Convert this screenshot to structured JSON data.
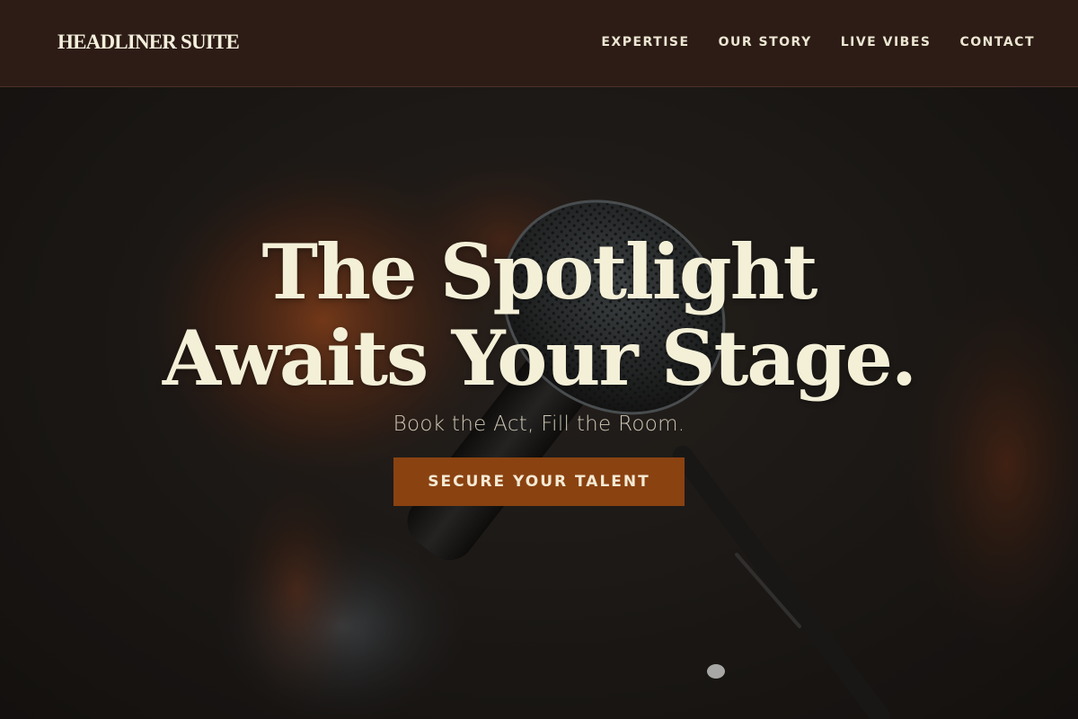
{
  "header": {
    "brand": "HEADLINER SUITE",
    "nav": [
      {
        "label": "EXPERTISE"
      },
      {
        "label": "OUR STORY"
      },
      {
        "label": "LIVE VIBES"
      },
      {
        "label": "CONTACT"
      }
    ]
  },
  "hero": {
    "headline_line1": "The Spotlight",
    "headline_line2": "Awaits Your Stage.",
    "subtitle": "Book the Act, Fill the Room.",
    "cta_label": "SECURE YOUR TALENT",
    "background_icon": "microphone-photo-icon"
  },
  "colors": {
    "header_bg": "#2d1c16",
    "headline": "#f4f0d8",
    "cta_bg": "#8a4211",
    "cta_text": "#f4ead4"
  }
}
